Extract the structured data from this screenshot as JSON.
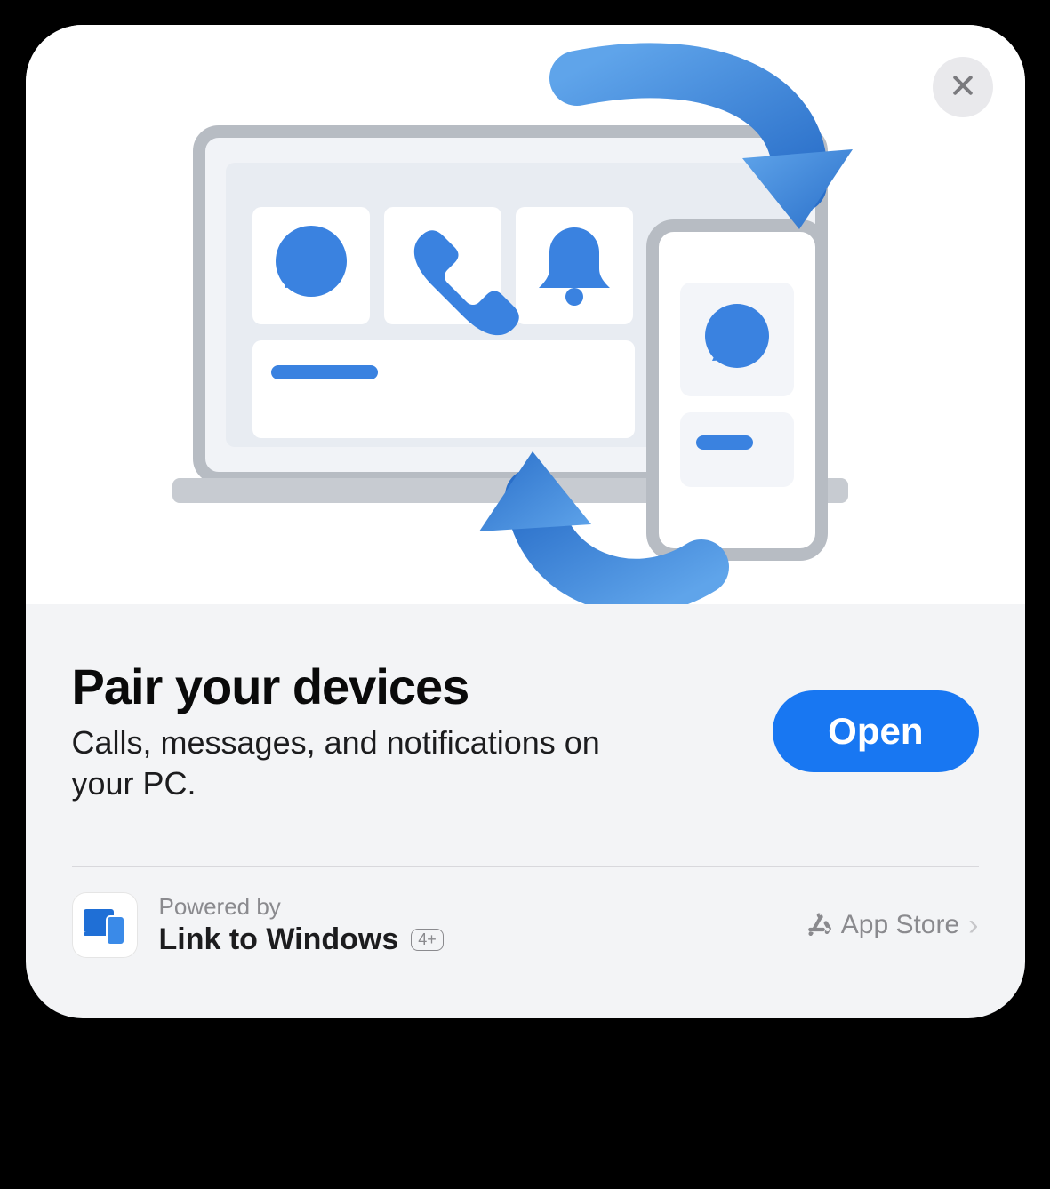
{
  "modal": {
    "close_icon": "close",
    "title": "Pair your devices",
    "subtitle": "Calls, messages, and notifications on your PC.",
    "primary_button": "Open"
  },
  "footer": {
    "powered_label": "Powered by",
    "app_name": "Link to Windows",
    "age_rating": "4+",
    "store_label": "App Store"
  },
  "illustration": {
    "tiles": [
      "chat-bubble",
      "phone",
      "bell"
    ],
    "phone_tiles": [
      "chat-bubble",
      "text-line"
    ],
    "arrows": "sync-bidirectional"
  },
  "colors": {
    "accent": "#2f7de1",
    "accent_dark": "#1f5fb8",
    "button": "#1877f2",
    "panel_stroke": "#b7bcc3",
    "tile_bg": "#ffffff",
    "sheet_bg": "#f3f4f6"
  }
}
